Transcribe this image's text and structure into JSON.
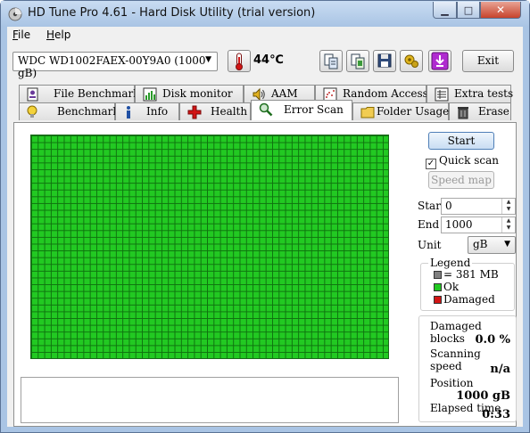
{
  "window": {
    "title": "HD Tune Pro 4.61 - Hard Disk Utility (trial version)",
    "controls": {
      "minimize": "▁",
      "maximize": "□",
      "close": "✕"
    }
  },
  "menu": [
    {
      "label": "File",
      "underline": "F",
      "rest": "ile"
    },
    {
      "label": "Help",
      "underline": "H",
      "rest": "elp"
    }
  ],
  "toolbar": {
    "drive": "WDC WD1002FAEX-00Y9A0 (1000 gB)",
    "temperature": "44℃",
    "exit_label": "Exit",
    "icons": [
      "copy-info-icon",
      "copy-screen-icon",
      "save-icon",
      "options-icon",
      "download-icon"
    ]
  },
  "tabs": {
    "top_row": [
      "File Benchmark",
      "Disk monitor",
      "AAM",
      "Random Access",
      "Extra tests"
    ],
    "bottom_row": [
      "Benchmark",
      "Info",
      "Health",
      "Error Scan",
      "Folder Usage",
      "Erase"
    ],
    "active": "Error Scan"
  },
  "controls": {
    "start_label": "Start",
    "quick_scan_label": "Quick scan",
    "quick_scan_checked": true,
    "speed_map_label": "Speed map",
    "start_field_label": "Start",
    "start_value": "0",
    "end_field_label": "End",
    "end_value": "1000",
    "unit_label": "Unit",
    "unit_value": "gB"
  },
  "legend": {
    "title": "Legend",
    "block_size": "= 381 MB",
    "ok": "Ok",
    "damaged": "Damaged"
  },
  "stats": {
    "damaged_blocks_label": "Damaged blocks",
    "damaged_blocks_value": "0.0 %",
    "scanning_speed_label": "Scanning speed",
    "scanning_speed_value": "n/a",
    "position_label": "Position",
    "position_value": "1000 gB",
    "elapsed_label": "Elapsed time",
    "elapsed_value": "0:33"
  },
  "colors": {
    "block_ok": "#22c922",
    "block_grid": "#0f730f",
    "block_damaged": "#d21414",
    "block_unit": "#808080"
  }
}
